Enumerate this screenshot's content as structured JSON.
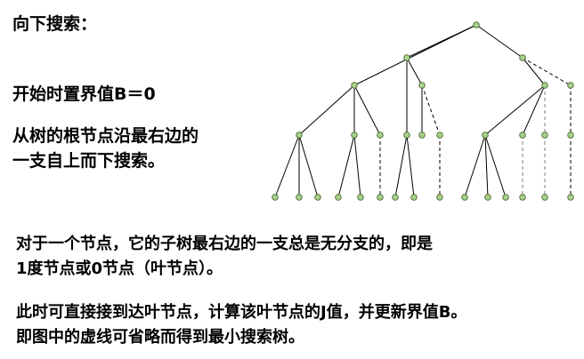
{
  "title": "向下搜索：",
  "init_text": "开始时置界值B＝0",
  "paragraph1": [
    "从树的根节点沿最右边的",
    "一支自上而下搜索。"
  ],
  "paragraph2": [
    "对于一个节点，它的子树最右边的一支总是无分支的，即是",
    "1度节点或0节点（叶节点）。"
  ],
  "paragraph3": [
    "此时可直接接到达叶节点，计算该叶节点的J值，并更新界值B。",
    "即图中的虚线可省略而得到最小搜索树。"
  ],
  "colors": {
    "node_fill": "#a9d18e",
    "node_stroke": "#4a6b2a",
    "edge": "#000000",
    "edge_grey": "#808080"
  }
}
